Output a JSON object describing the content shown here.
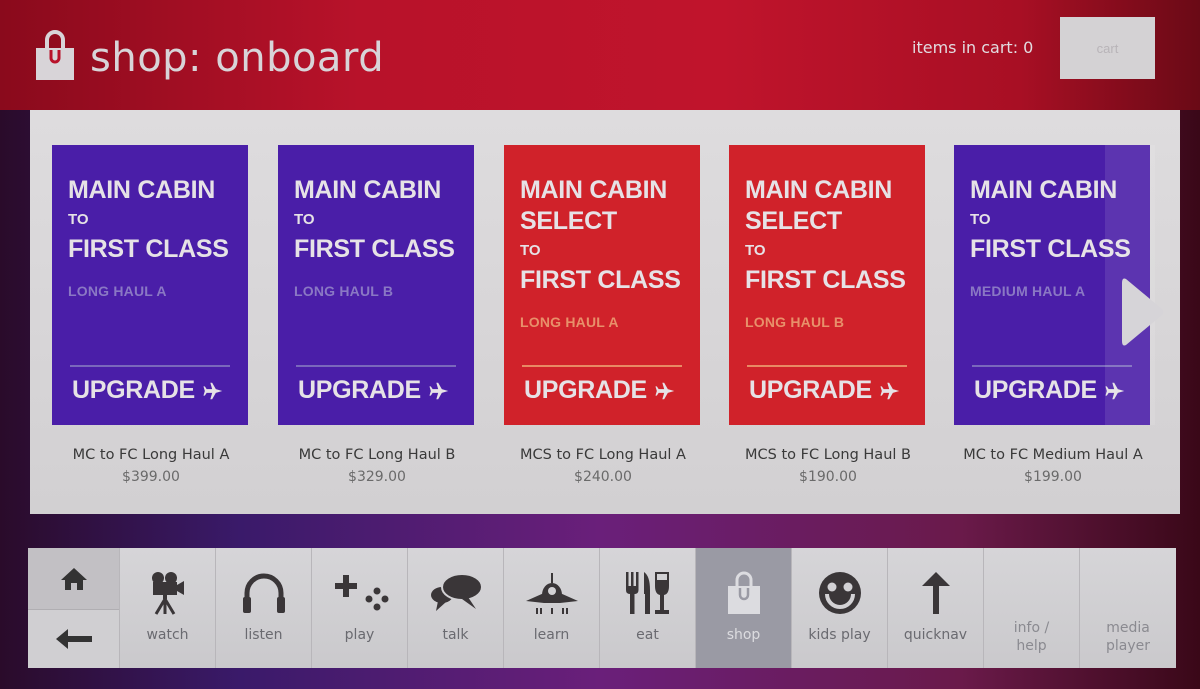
{
  "header": {
    "title": "shop: onboard",
    "icon": "shopping-bag-icon",
    "cart_count_label": "items in cart: 0",
    "cart_button_label": "cart"
  },
  "colors": {
    "header_red": "#c0142c",
    "tile_purple": "#4a1ea8",
    "tile_red": "#d0222a",
    "nav_active": "#9a9aa4"
  },
  "products": [
    {
      "tile_lines": [
        "MAIN CABIN"
      ],
      "to": "TO",
      "dest": "FIRST CLASS",
      "haul": "LONG HAUL A",
      "cta": "UPGRADE",
      "name": "MC to FC Long Haul A",
      "price": "$399.00",
      "color": "purple"
    },
    {
      "tile_lines": [
        "MAIN CABIN"
      ],
      "to": "TO",
      "dest": "FIRST CLASS",
      "haul": "LONG HAUL B",
      "cta": "UPGRADE",
      "name": "MC to FC Long Haul B",
      "price": "$329.00",
      "color": "purple"
    },
    {
      "tile_lines": [
        "MAIN CABIN",
        "SELECT"
      ],
      "to": "TO",
      "dest": "FIRST CLASS",
      "haul": "LONG HAUL A",
      "cta": "UPGRADE",
      "name": "MCS to FC Long Haul A",
      "price": "$240.00",
      "color": "red"
    },
    {
      "tile_lines": [
        "MAIN CABIN",
        "SELECT"
      ],
      "to": "TO",
      "dest": "FIRST CLASS",
      "haul": "LONG HAUL B",
      "cta": "UPGRADE",
      "name": "MCS to FC Long Haul B",
      "price": "$190.00",
      "color": "red"
    },
    {
      "tile_lines": [
        "MAIN CABIN"
      ],
      "to": "TO",
      "dest": "FIRST CLASS",
      "haul": "MEDIUM HAUL A",
      "cta": "UPGRADE",
      "name": "MC to FC Medium Haul A",
      "price": "$199.00",
      "color": "purple"
    }
  ],
  "nav": {
    "home_icon": "home-icon",
    "back_icon": "back-arrow-icon",
    "items": [
      {
        "label": "watch",
        "icon": "movie-camera-icon"
      },
      {
        "label": "listen",
        "icon": "headphones-icon"
      },
      {
        "label": "play",
        "icon": "gamepad-icon"
      },
      {
        "label": "talk",
        "icon": "chat-bubbles-icon"
      },
      {
        "label": "learn",
        "icon": "airplane-icon"
      },
      {
        "label": "eat",
        "icon": "fork-knife-glass-icon"
      },
      {
        "label": "shop",
        "icon": "shopping-bag-icon",
        "active": true
      },
      {
        "label": "kids play",
        "icon": "smiley-icon"
      },
      {
        "label": "quicknav",
        "icon": "up-arrow-icon"
      },
      {
        "label": "info / help",
        "line1": "info /",
        "line2": "help"
      },
      {
        "label": "media player",
        "line1": "media",
        "line2": "player"
      }
    ]
  }
}
